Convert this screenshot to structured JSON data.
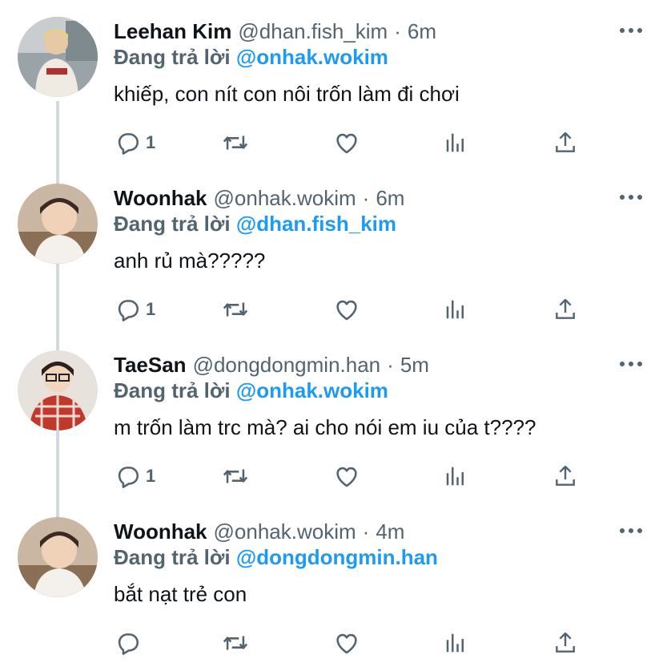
{
  "reply_prefix": "Đang trả lời",
  "tweets": [
    {
      "name": "Leehan Kim",
      "handle": "@dhan.fish_kim",
      "time": "6m",
      "reply_to": "@onhak.wokim",
      "text": "khiếp, con nít con nôi trốn làm đi chơi",
      "reply_count": "1",
      "avatar_icon": "avatar-photo"
    },
    {
      "name": "Woonhak",
      "handle": "@onhak.wokim",
      "time": "6m",
      "reply_to": "@dhan.fish_kim",
      "text": "anh rủ mà?????",
      "reply_count": "1",
      "avatar_icon": "avatar-photo"
    },
    {
      "name": "TaeSan",
      "handle": "@dongdongmin.han",
      "time": "5m",
      "reply_to": "@onhak.wokim",
      "text": "m trốn làm trc mà? ai cho nói em iu của t????",
      "reply_count": "1",
      "avatar_icon": "avatar-photo"
    },
    {
      "name": "Woonhak",
      "handle": "@onhak.wokim",
      "time": "4m",
      "reply_to": "@dongdongmin.han",
      "text": "bắt nạt trẻ con",
      "reply_count": "",
      "avatar_icon": "avatar-photo"
    }
  ],
  "action_icons": [
    "reply-icon",
    "retweet-icon",
    "like-icon",
    "analytics-icon",
    "share-icon"
  ],
  "colors": {
    "text": "#0f1419",
    "secondary": "#536471",
    "link": "#1d9bf0",
    "thread_line": "#cfd9de"
  },
  "sep_dot": "·"
}
